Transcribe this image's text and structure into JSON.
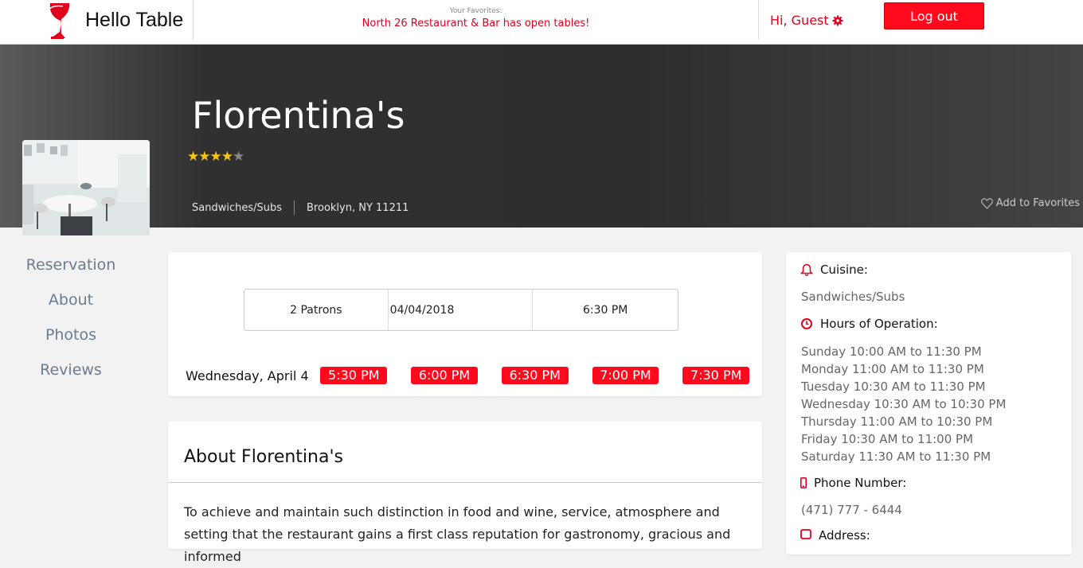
{
  "header": {
    "brand": "Hello Table",
    "favorites_label": "Your Favorites:",
    "favorites_message": "North 26 Restaurant & Bar has open tables!",
    "greeting": "Hi, Guest",
    "logout_label": "Log out"
  },
  "restaurant": {
    "name": "Florentina's",
    "rating": 4,
    "rating_max": 5,
    "cuisine": "Sandwiches/Subs",
    "location": "Brooklyn, NY 11211",
    "add_favorites": "Add to Favorites"
  },
  "nav": {
    "items": [
      "Reservation",
      "About",
      "Photos",
      "Reviews"
    ]
  },
  "reservation": {
    "patrons": "2 Patrons",
    "date": "04/04/2018",
    "time": "6:30 PM",
    "day_label": "Wednesday, April 4",
    "slots": [
      "5:30 PM",
      "6:00 PM",
      "6:30 PM",
      "7:00 PM",
      "7:30 PM"
    ]
  },
  "about": {
    "title": "About Florentina's",
    "text": "To achieve and maintain such distinction in food and wine, service, atmosphere and setting that the restaurant gains a first class reputation for gastronomy, gracious and informed"
  },
  "info": {
    "cuisine_label": "Cuisine:",
    "cuisine_value": "Sandwiches/Subs",
    "hours_label": "Hours of Operation:",
    "hours": [
      "Sunday 10:00 AM to 11:30 PM",
      "Monday 11:00 AM to 11:30 PM",
      "Tuesday 10:30 AM to 11:30 PM",
      "Wednesday 10:30 AM to 10:30 PM",
      "Thursday 11:00 AM to 10:30 PM",
      "Friday 10:30 AM to 11:00 PM",
      "Saturday 11:30 AM to 11:30 PM"
    ],
    "phone_label": "Phone Number:",
    "phone_value": "(471) 777 - 6444",
    "address_label": "Address:"
  },
  "colors": {
    "accent": "#ff0a1c",
    "nav_text": "#6a7c8f"
  }
}
